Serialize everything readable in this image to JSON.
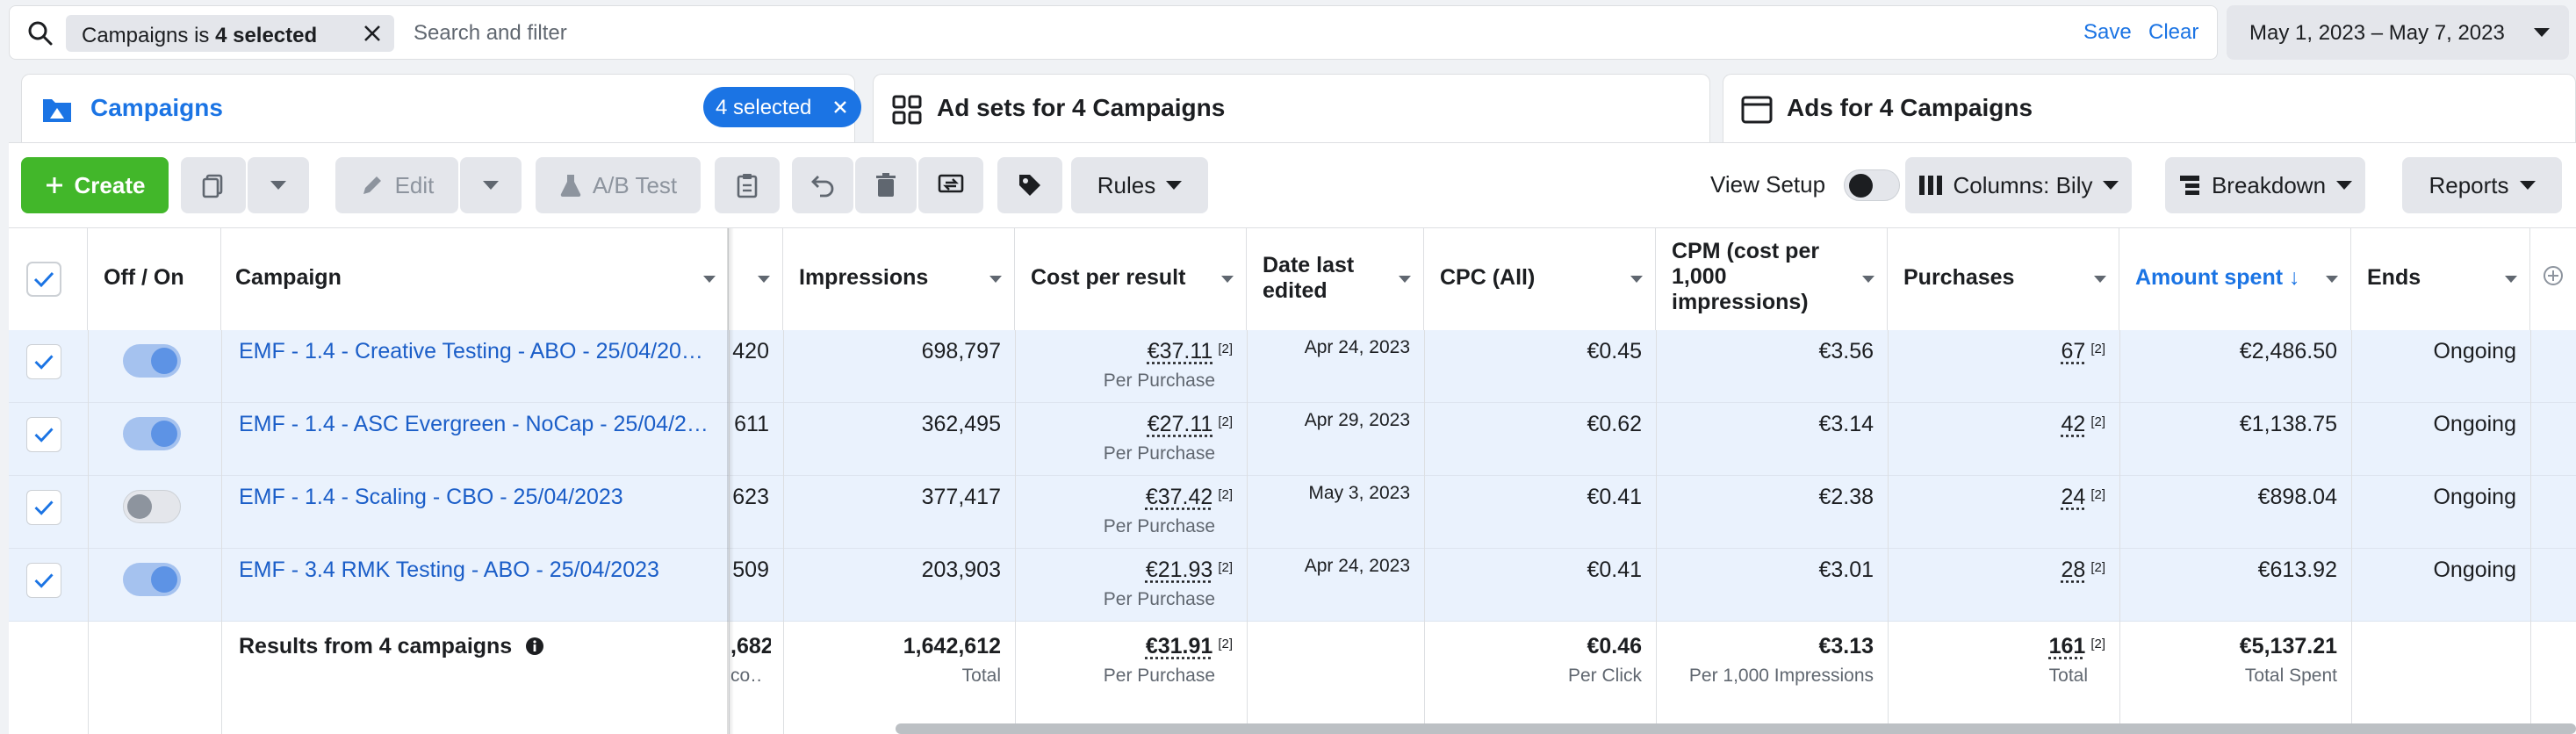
{
  "filter_bar": {
    "chip_field": "Campaigns is",
    "chip_value": "4 selected",
    "search_placeholder": "Search and filter",
    "save_label": "Save",
    "clear_label": "Clear"
  },
  "date_range": "May 1, 2023 – May 7, 2023",
  "tabs": {
    "campaigns": {
      "label": "Campaigns",
      "badge": "4 selected"
    },
    "adsets": {
      "label": "Ad sets for 4 Campaigns"
    },
    "ads": {
      "label": "Ads for 4 Campaigns"
    }
  },
  "toolbar": {
    "create_label": "Create",
    "edit_label": "Edit",
    "ab_test_label": "A/B Test",
    "rules_label": "Rules",
    "view_setup_label": "View Setup",
    "columns_label": "Columns: Bily",
    "breakdown_label": "Breakdown",
    "reports_label": "Reports"
  },
  "columns": {
    "off_on": "Off / On",
    "campaign": "Campaign",
    "impressions": "Impressions",
    "cost_per_result": "Cost per result",
    "date_last_edited": "Date last edited",
    "cpc": "CPC (All)",
    "cpm": "CPM (cost per 1,000 impressions)",
    "purchases": "Purchases",
    "amount_spent": "Amount spent ↓",
    "ends": "Ends"
  },
  "rows": [
    {
      "name": "EMF - 1.4 - Creative Testing - ABO - 25/04/20…",
      "hidden_col": "420",
      "impressions": "698,797",
      "cost_per_result": "€37.11",
      "cpr_sup": "[2]",
      "cpr_sub": "Per Purchase",
      "date_edited": "Apr 24, 2023",
      "cpc": "€0.45",
      "cpm": "€3.56",
      "purchases": "67",
      "purch_sup": "[2]",
      "amount_spent": "€2,486.50",
      "ends": "Ongoing",
      "on": true
    },
    {
      "name": "EMF - 1.4 - ASC Evergreen - NoCap - 25/04/2…",
      "hidden_col": "611",
      "impressions": "362,495",
      "cost_per_result": "€27.11",
      "cpr_sup": "[2]",
      "cpr_sub": "Per Purchase",
      "date_edited": "Apr 29, 2023",
      "cpc": "€0.62",
      "cpm": "€3.14",
      "purchases": "42",
      "purch_sup": "[2]",
      "amount_spent": "€1,138.75",
      "ends": "Ongoing",
      "on": true
    },
    {
      "name": "EMF - 1.4 - Scaling - CBO - 25/04/2023",
      "hidden_col": "623",
      "impressions": "377,417",
      "cost_per_result": "€37.42",
      "cpr_sup": "[2]",
      "cpr_sub": "Per Purchase",
      "date_edited": "May 3, 2023",
      "cpc": "€0.41",
      "cpm": "€2.38",
      "purchases": "24",
      "purch_sup": "[2]",
      "amount_spent": "€898.04",
      "ends": "Ongoing",
      "on": false
    },
    {
      "name": "EMF - 3.4 RMK Testing - ABO - 25/04/2023",
      "hidden_col": "509",
      "impressions": "203,903",
      "cost_per_result": "€21.93",
      "cpr_sup": "[2]",
      "cpr_sub": "Per Purchase",
      "date_edited": "Apr 24, 2023",
      "cpc": "€0.41",
      "cpm": "€3.01",
      "purchases": "28",
      "purch_sup": "[2]",
      "amount_spent": "€613.92",
      "ends": "Ongoing",
      "on": true
    }
  ],
  "totals": {
    "label": "Results from 4 campaigns",
    "hidden_col": ",682",
    "hidden_sub": "co…",
    "impressions": "1,642,612",
    "impressions_sub": "Total",
    "cost_per_result": "€31.91",
    "cpr_sup": "[2]",
    "cpr_sub": "Per Purchase",
    "cpc": "€0.46",
    "cpc_sub": "Per Click",
    "cpm": "€3.13",
    "cpm_sub": "Per 1,000 Impressions",
    "purchases": "161",
    "purch_sup": "[2]",
    "purchases_sub": "Total",
    "amount_spent": "€5,137.21",
    "amount_sub": "Total Spent"
  },
  "colors": {
    "accent": "#1b74e4",
    "create_green": "#42b72a",
    "selected_row": "#eaf2fd",
    "link": "#1b5ec8"
  },
  "icons": [
    "search-icon",
    "close-icon",
    "campaigns-icon",
    "adsets-icon",
    "ads-icon",
    "plus-icon",
    "duplicate-icon",
    "pencil-icon",
    "flask-icon",
    "clipboard-icon",
    "undo-icon",
    "trash-icon",
    "sync-icon",
    "tag-icon",
    "columns-icon",
    "breakdown-icon",
    "info-icon",
    "add-column-icon",
    "checkbox-icon"
  ]
}
